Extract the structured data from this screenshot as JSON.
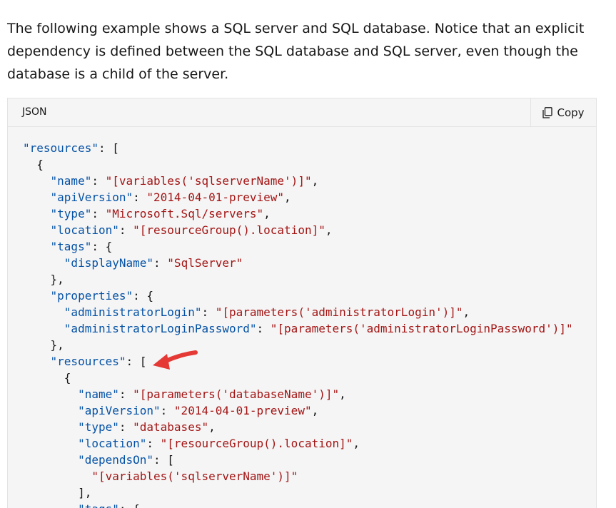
{
  "intro": {
    "text": "The following example shows a SQL server and SQL database. Notice that an explicit dependency is defined between the SQL database and SQL server, even though the database is a child of the server."
  },
  "code_block": {
    "language": "JSON",
    "copy_label": "Copy",
    "copy_icon": "copy-icon",
    "colors": {
      "key": "#0451a5",
      "string": "#a31515",
      "punctuation": "#171717",
      "background": "#f5f5f5",
      "arrow": "#e53935"
    },
    "lines": [
      [
        {
          "t": "k",
          "v": "\"resources\""
        },
        {
          "t": "p",
          "v": ": ["
        }
      ],
      [
        {
          "t": "p",
          "v": "  {"
        }
      ],
      [
        {
          "t": "p",
          "v": "    "
        },
        {
          "t": "k",
          "v": "\"name\""
        },
        {
          "t": "p",
          "v": ": "
        },
        {
          "t": "s",
          "v": "\"[variables('sqlserverName')]\""
        },
        {
          "t": "p",
          "v": ","
        }
      ],
      [
        {
          "t": "p",
          "v": "    "
        },
        {
          "t": "k",
          "v": "\"apiVersion\""
        },
        {
          "t": "p",
          "v": ": "
        },
        {
          "t": "s",
          "v": "\"2014-04-01-preview\""
        },
        {
          "t": "p",
          "v": ","
        }
      ],
      [
        {
          "t": "p",
          "v": "    "
        },
        {
          "t": "k",
          "v": "\"type\""
        },
        {
          "t": "p",
          "v": ": "
        },
        {
          "t": "s",
          "v": "\"Microsoft.Sql/servers\""
        },
        {
          "t": "p",
          "v": ","
        }
      ],
      [
        {
          "t": "p",
          "v": "    "
        },
        {
          "t": "k",
          "v": "\"location\""
        },
        {
          "t": "p",
          "v": ": "
        },
        {
          "t": "s",
          "v": "\"[resourceGroup().location]\""
        },
        {
          "t": "p",
          "v": ","
        }
      ],
      [
        {
          "t": "p",
          "v": "    "
        },
        {
          "t": "k",
          "v": "\"tags\""
        },
        {
          "t": "p",
          "v": ": {"
        }
      ],
      [
        {
          "t": "p",
          "v": "      "
        },
        {
          "t": "k",
          "v": "\"displayName\""
        },
        {
          "t": "p",
          "v": ": "
        },
        {
          "t": "s",
          "v": "\"SqlServer\""
        }
      ],
      [
        {
          "t": "p",
          "v": "    },"
        }
      ],
      [
        {
          "t": "p",
          "v": "    "
        },
        {
          "t": "k",
          "v": "\"properties\""
        },
        {
          "t": "p",
          "v": ": {"
        }
      ],
      [
        {
          "t": "p",
          "v": "      "
        },
        {
          "t": "k",
          "v": "\"administratorLogin\""
        },
        {
          "t": "p",
          "v": ": "
        },
        {
          "t": "s",
          "v": "\"[parameters('administratorLogin')]\""
        },
        {
          "t": "p",
          "v": ","
        }
      ],
      [
        {
          "t": "p",
          "v": "      "
        },
        {
          "t": "k",
          "v": "\"administratorLoginPassword\""
        },
        {
          "t": "p",
          "v": ": "
        },
        {
          "t": "s",
          "v": "\"[parameters('administratorLoginPassword')]\""
        }
      ],
      [
        {
          "t": "p",
          "v": "    },"
        }
      ],
      [
        {
          "t": "p",
          "v": "    "
        },
        {
          "t": "k",
          "v": "\"resources\""
        },
        {
          "t": "p",
          "v": ": ["
        }
      ],
      [
        {
          "t": "p",
          "v": "      {"
        }
      ],
      [
        {
          "t": "p",
          "v": "        "
        },
        {
          "t": "k",
          "v": "\"name\""
        },
        {
          "t": "p",
          "v": ": "
        },
        {
          "t": "s",
          "v": "\"[parameters('databaseName')]\""
        },
        {
          "t": "p",
          "v": ","
        }
      ],
      [
        {
          "t": "p",
          "v": "        "
        },
        {
          "t": "k",
          "v": "\"apiVersion\""
        },
        {
          "t": "p",
          "v": ": "
        },
        {
          "t": "s",
          "v": "\"2014-04-01-preview\""
        },
        {
          "t": "p",
          "v": ","
        }
      ],
      [
        {
          "t": "p",
          "v": "        "
        },
        {
          "t": "k",
          "v": "\"type\""
        },
        {
          "t": "p",
          "v": ": "
        },
        {
          "t": "s",
          "v": "\"databases\""
        },
        {
          "t": "p",
          "v": ","
        }
      ],
      [
        {
          "t": "p",
          "v": "        "
        },
        {
          "t": "k",
          "v": "\"location\""
        },
        {
          "t": "p",
          "v": ": "
        },
        {
          "t": "s",
          "v": "\"[resourceGroup().location]\""
        },
        {
          "t": "p",
          "v": ","
        }
      ],
      [
        {
          "t": "p",
          "v": "        "
        },
        {
          "t": "k",
          "v": "\"dependsOn\""
        },
        {
          "t": "p",
          "v": ": ["
        }
      ],
      [
        {
          "t": "p",
          "v": "          "
        },
        {
          "t": "s",
          "v": "\"[variables('sqlserverName')]\""
        }
      ],
      [
        {
          "t": "p",
          "v": "        ],"
        }
      ],
      [
        {
          "t": "p",
          "v": "        "
        },
        {
          "t": "k",
          "v": "\"tags\""
        },
        {
          "t": "p",
          "v": ": {"
        }
      ]
    ]
  }
}
